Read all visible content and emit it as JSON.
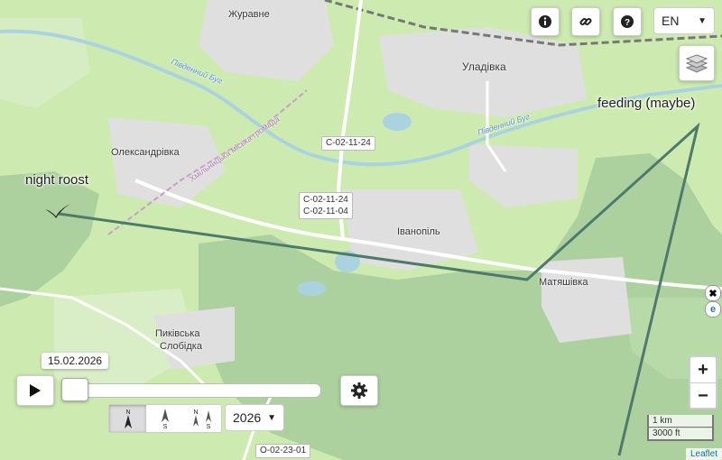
{
  "map": {
    "places": {
      "zhuravne": "Журавне",
      "uladivka": "Уладівка",
      "oleksandrivka": "Олександрівка",
      "ivanopil": "Іванопіль",
      "matiashivka": "Матяшівка",
      "pykivska_slobidka_1": "Пиківська",
      "pykivska_slobidka_2": "Слобідка"
    },
    "roads": {
      "c_02_11_24_a": "C-02-11-24",
      "c_02_11_24_b": "C-02-11-24",
      "c_02_11_04": "C-02-11-04",
      "o_02_23_01": "O-02-23-01"
    },
    "rivers": {
      "pivdennyi_buh_1": "Південний Буг",
      "pivdennyi_buh_2": "Південний Буг"
    },
    "admin": {
      "khmilnyk_hromada": "Хмільницька міська громада"
    },
    "annotations": {
      "night_roost": "night roost",
      "feeding": "feeding (maybe)"
    }
  },
  "controls": {
    "info_icon": "info-icon",
    "link_icon": "link-icon",
    "help_icon": "help-icon",
    "language": "EN",
    "layers_icon": "layers-icon",
    "zoom_in": "+",
    "zoom_out": "−",
    "scale_km": "1 km",
    "scale_ft": "3000 ft",
    "attribution": "Leaflet"
  },
  "timeline": {
    "date": "15.02.2026",
    "year": "2026",
    "play_icon": "play-icon",
    "settings_icon": "gear-icon",
    "orientation": {
      "north": "N",
      "south_a": "S",
      "north_b": "N",
      "south_b": "S"
    }
  },
  "colors": {
    "forest": "#add19e",
    "meadow": "#cdebb0",
    "residential": "#e0dfdf",
    "track": "#4d7a6b",
    "water": "#aad3df"
  }
}
